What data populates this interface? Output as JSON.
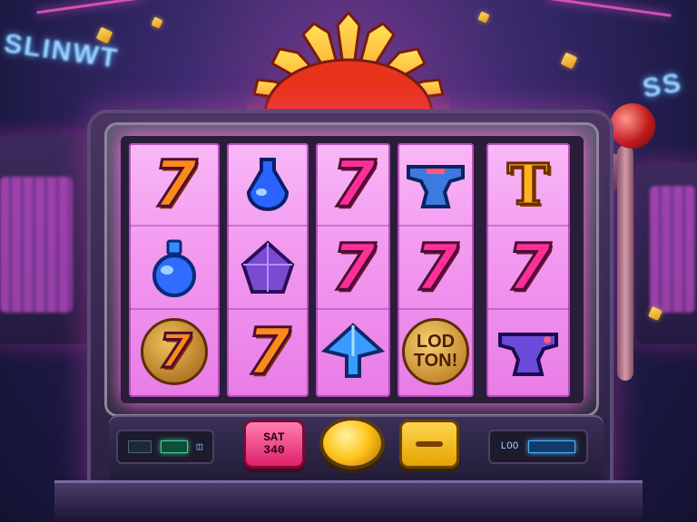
{
  "background": {
    "left_sign": "SLINWT",
    "right_sign": "SS"
  },
  "reels": [
    [
      "seven-orange",
      "potion-blue",
      "seven-orange-coin"
    ],
    [
      "seven-orange",
      "gem-purple",
      "seven-orange"
    ],
    [
      "seven-pink",
      "seven-pink",
      "diamond-blue"
    ],
    [
      "anvil-blue",
      "seven-pink",
      "lotton-coin"
    ],
    [
      "t-gold",
      "seven-pink",
      "anvil-blue"
    ]
  ],
  "symbols": {
    "seven_glyph": "7",
    "t_glyph": "T",
    "lotton_line1": "LOD",
    "lotton_line2": "TON!"
  },
  "panel": {
    "sat_button_line1": "SAT",
    "sat_button_line2": "340",
    "right_display_label": "LOO"
  },
  "colors": {
    "reel_bg": "#f39bf0",
    "seven_orange": "#ff8a1c",
    "seven_pink": "#ff2e9a",
    "lever_knob": "#c01b1b",
    "spin_button": "#ffc21a"
  }
}
